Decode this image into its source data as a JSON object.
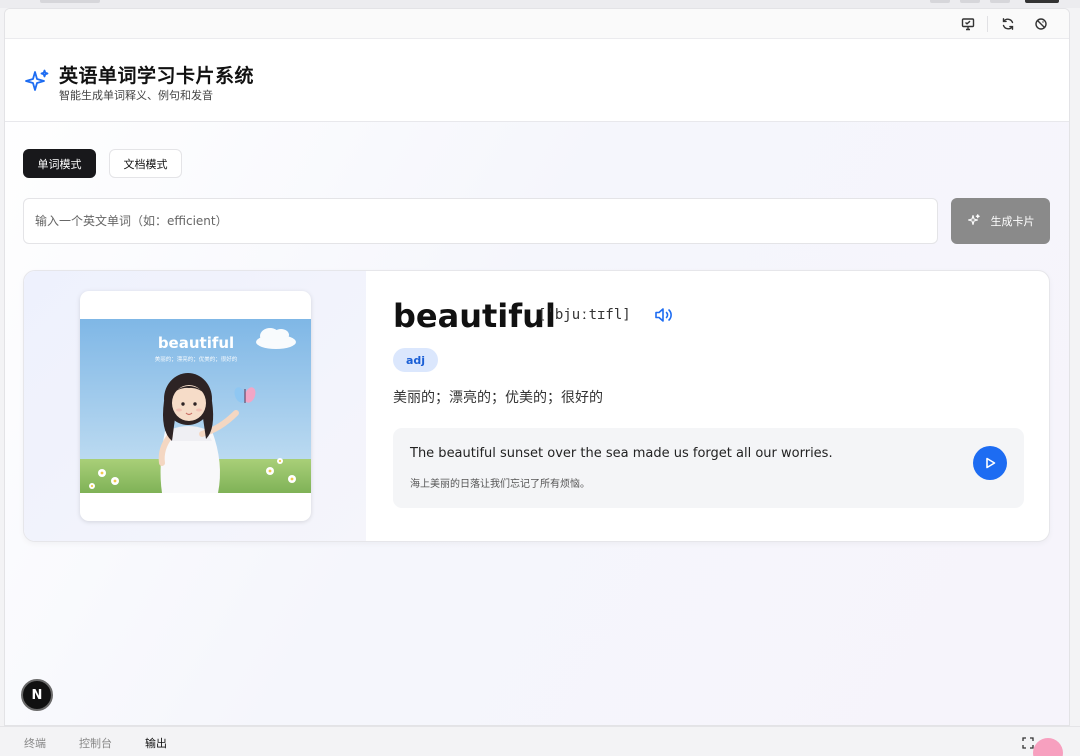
{
  "toolbar": {
    "icons": [
      "monitor-icon",
      "refresh-icon",
      "reset-icon"
    ]
  },
  "header": {
    "title": "英语单词学习卡片系统",
    "subtitle": "智能生成单词释义、例句和发音"
  },
  "modes": {
    "word_mode": "单词模式",
    "doc_mode": "文档模式",
    "active": "word_mode"
  },
  "search": {
    "placeholder": "输入一个英文单词（如：efficient）",
    "value": ""
  },
  "generate_button": {
    "label": "生成卡片"
  },
  "card": {
    "illustration": {
      "word": "beautiful",
      "caption": "美丽的；漂亮的；优美的；很好的"
    },
    "word": "beautiful",
    "phonetic": "[ˈbjuːtɪfl]",
    "part_of_speech": "adj",
    "meaning": "美丽的；漂亮的；优美的；很好的",
    "example_en": "The beautiful sunset over the sea made us forget all our worries.",
    "example_zh": "海上美丽的日落让我们忘记了所有烦恼。"
  },
  "badge": {
    "letter": "N"
  },
  "bottom_tabs": [
    {
      "label": "终端",
      "active": false
    },
    {
      "label": "控制台",
      "active": false
    },
    {
      "label": "输出",
      "active": true
    }
  ],
  "colors": {
    "accent": "#1d6cf2",
    "primary_dark": "#18181b",
    "pos_bg": "#dbe7fd",
    "generate_disabled": "#8a8a8a"
  }
}
